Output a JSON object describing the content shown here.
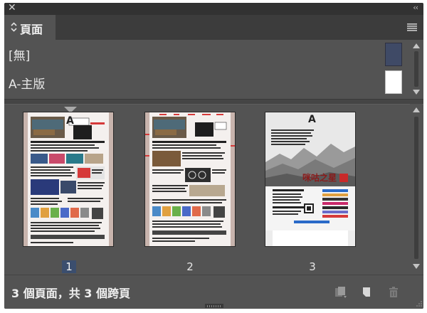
{
  "window": {
    "close_glyph": "✕",
    "collapse_glyph": "‹‹"
  },
  "tab": {
    "label": "頁面",
    "chevron_icon": "chevron-updown-icon",
    "menu_icon": "panel-menu-icon"
  },
  "masters": [
    {
      "name": "[無]",
      "thumb": "none"
    },
    {
      "name": "A-主版",
      "thumb": "master"
    }
  ],
  "pages": [
    {
      "number": "1",
      "selected": true,
      "master_label": "A",
      "style": "newsletter"
    },
    {
      "number": "2",
      "selected": false,
      "master_label": "",
      "style": "newsletter"
    },
    {
      "number": "3",
      "selected": false,
      "master_label": "A",
      "style": "poster",
      "headline": "咪咕之星"
    }
  ],
  "footer": {
    "status": "3 個頁面，共 3 個跨頁",
    "buttons": [
      "edit-page-size-icon",
      "new-page-icon",
      "delete-page-icon"
    ]
  },
  "colors": {
    "panel_bg": "#535353",
    "selected_page": "#3b4e6e",
    "page_bg": "#c8b4ad",
    "guide_red": "#d63a3a"
  }
}
